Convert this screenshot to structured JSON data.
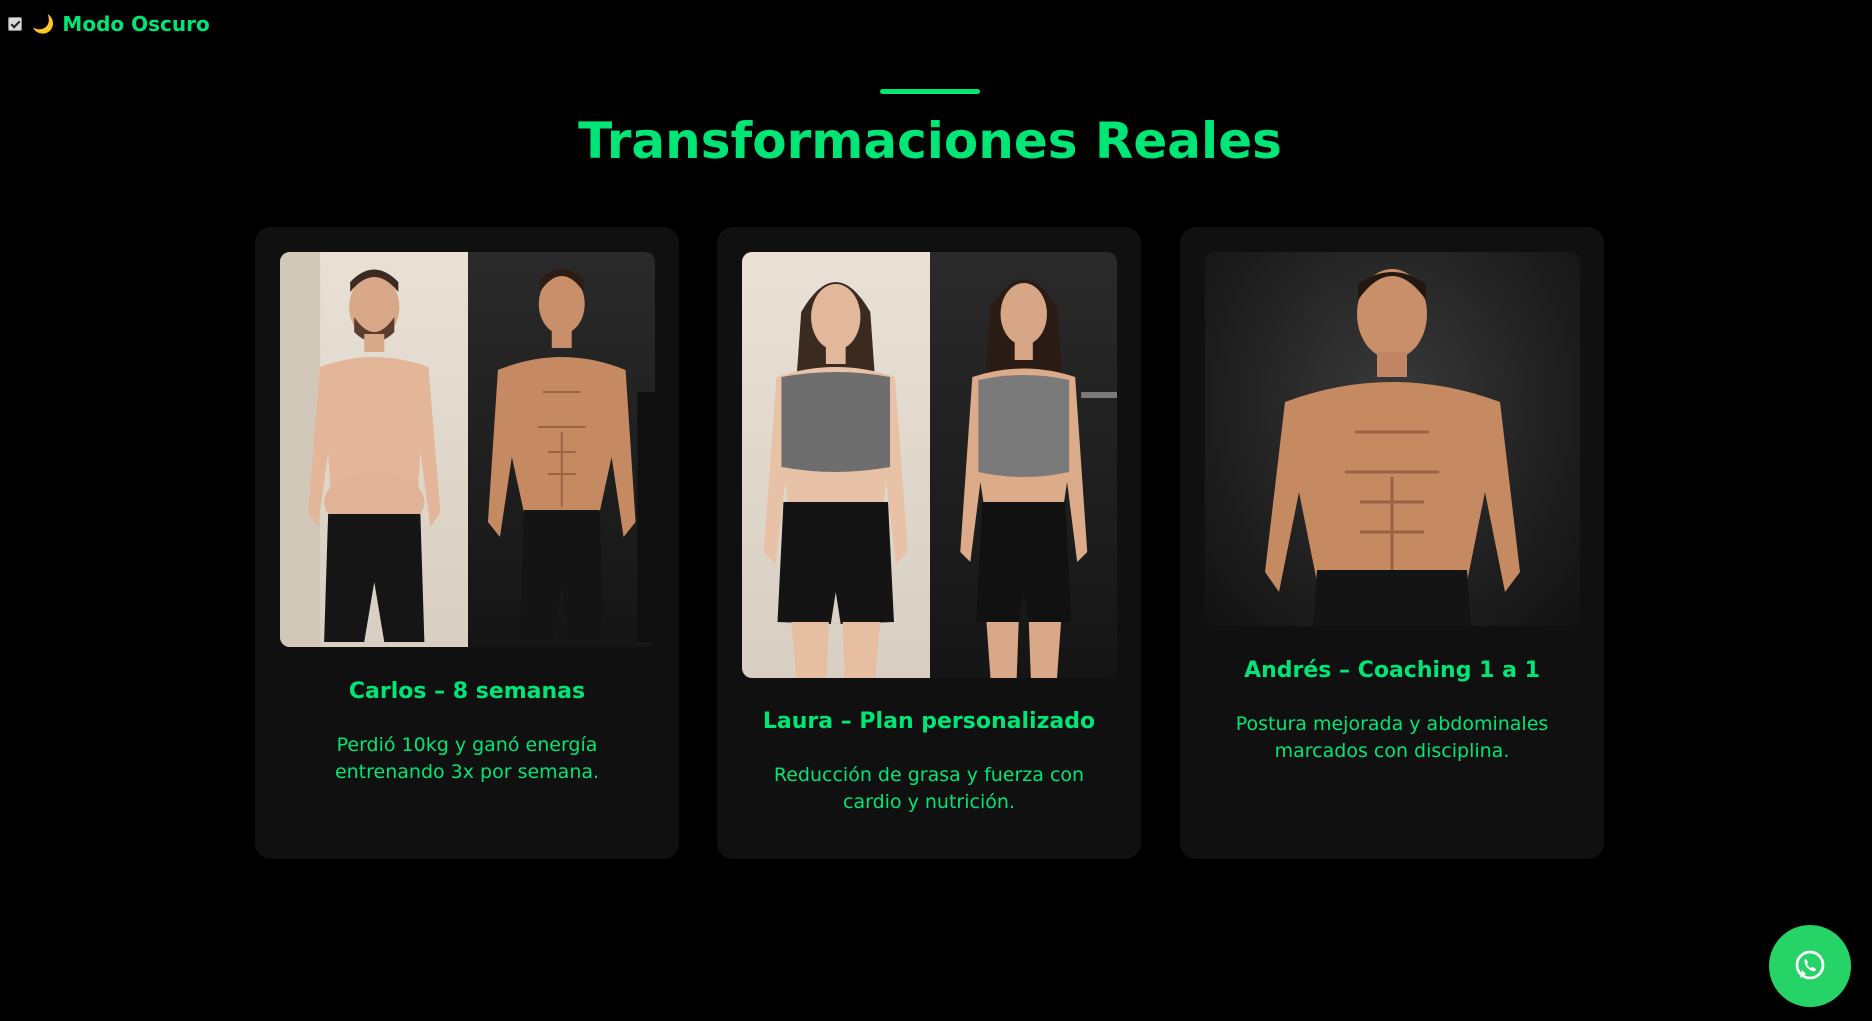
{
  "dark_mode": {
    "label": "Modo Oscuro",
    "checked": true,
    "icon": "moon-icon"
  },
  "section": {
    "title": "Transformaciones Reales"
  },
  "cards": [
    {
      "title": "Carlos – 8 semanas",
      "description": "Perdió 10kg y ganó energía entrenando 3x por semana.",
      "photo": "before-after-photo-carlos"
    },
    {
      "title": "Laura – Plan personalizado",
      "description": "Reducción de grasa y fuerza con cardio y nutrición.",
      "photo": "before-after-photo-laura"
    },
    {
      "title": "Andrés – Coaching 1 a 1",
      "description": "Postura mejorada y abdominales marcados con disciplina.",
      "photo": "photo-andres"
    }
  ],
  "whatsapp": {
    "icon": "whatsapp-icon",
    "color": "#25d366"
  },
  "colors": {
    "accent": "#00e676",
    "background": "#000000",
    "card": "#101010"
  }
}
